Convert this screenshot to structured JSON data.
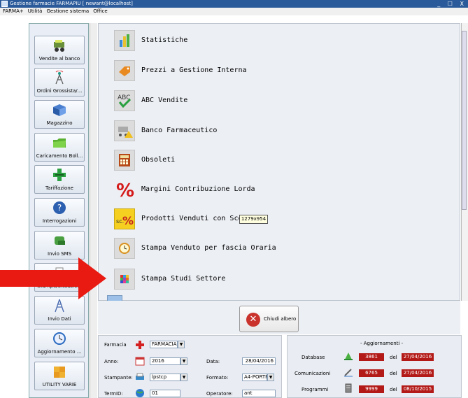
{
  "window": {
    "title": "Gestione farmacie FARMAPIU [ newant@localhost]",
    "controls": "_ ☐ X"
  },
  "menu": [
    "FARMA+",
    "Utilità",
    "Gestione sistema",
    "Office"
  ],
  "sidebar": {
    "items": [
      {
        "label": "Vendite al banco",
        "icon": "cart-icon"
      },
      {
        "label": "Ordini Grossista/...",
        "icon": "antenna-icon"
      },
      {
        "label": "Magazzino",
        "icon": "box-icon"
      },
      {
        "label": "Caricamento Boll...",
        "icon": "folder-icon"
      },
      {
        "label": "Tariffazione",
        "icon": "pharmacy-cross-icon"
      },
      {
        "label": "Interrogazioni",
        "icon": "question-icon"
      },
      {
        "label": "Invio SMS",
        "icon": "sms-icon"
      },
      {
        "label": "Stampe/Situazioni",
        "icon": "printer-icon"
      },
      {
        "label": "Invio Dati",
        "icon": "tower-icon"
      },
      {
        "label": "Aggiornamento ...",
        "icon": "clock-icon"
      },
      {
        "label": "UTILITY VARIE",
        "icon": "puzzle-icon"
      }
    ]
  },
  "tree": {
    "items": [
      {
        "label": "Statistiche",
        "icon": "bar-chart-icon"
      },
      {
        "label": "Prezzi a Gestione Interna",
        "icon": "price-tag-icon"
      },
      {
        "label": "ABC Vendite",
        "icon": "abc-check-icon"
      },
      {
        "label": "Banco Farmaceutico",
        "icon": "cart-warning-icon"
      },
      {
        "label": "Obsoleti",
        "icon": "calculator-icon"
      },
      {
        "label": "Margini Contribuzione Lorda",
        "icon": "percent-icon"
      },
      {
        "label": "Prodotti Venduti con Sconto",
        "icon": "discount-percent-icon"
      },
      {
        "label": "Stampa Venduto per fascia Oraria",
        "icon": "clock-icon"
      },
      {
        "label": "Stampa Studi Settore",
        "icon": "color-grid-icon"
      }
    ],
    "tooltip": "1279x954"
  },
  "close_button": {
    "label": "Chiudi albero"
  },
  "bottom_left": {
    "farmacia_label": "Farmacia",
    "farmacia_value": "FARMACIA",
    "anno_label": "Anno:",
    "anno_value": "2016",
    "data_label": "Data:",
    "data_value": "28/04/2016",
    "stampante_label": "Stampante:",
    "stampante_value": "lpstcp",
    "formato_label": "Formato:",
    "formato_value": "A4-PORTR",
    "termid_label": "TermID:",
    "termid_value": "01",
    "operatore_label": "Operatore:",
    "operatore_value": "ant"
  },
  "bottom_right": {
    "title": "- Aggiornamenti -",
    "rows": [
      {
        "label": "Database",
        "value": "3861",
        "del": "del",
        "date": "27/04/2016",
        "date_red": true
      },
      {
        "label": "Comunicazioni",
        "value": "6765",
        "del": "del",
        "date": "27/04/2016",
        "date_red": true
      },
      {
        "label": "Programmi",
        "value": "9999",
        "del": "del",
        "date": "08/10/2015",
        "date_red": true
      }
    ]
  },
  "colors": {
    "titlebar": "#2a5a9a",
    "red_value": "#b31a17",
    "arrow": "#e81a12"
  }
}
